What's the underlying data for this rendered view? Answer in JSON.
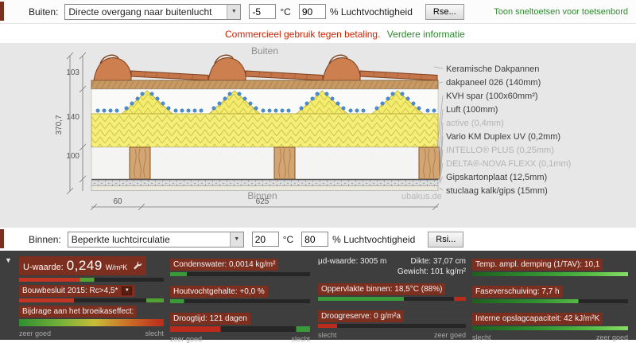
{
  "top_bar": {
    "label": "Buiten:",
    "select_value": "Directe overgang naar buitenlucht",
    "temp_value": "-5",
    "temp_unit": "°C",
    "humidity_value": "90",
    "humidity_unit": "% Luchtvochtigheid",
    "surface_button": "Rse...",
    "shortcuts_link": "Toon sneltoetsen voor toetsenbord"
  },
  "notice": {
    "commercial_text": "Commercieel gebruik tegen betaling.",
    "info_link": "Verdere informatie"
  },
  "drawing": {
    "outside_label": "Buiten",
    "inside_label": "Binnen",
    "watermark": "ubakus.de",
    "dims": {
      "total": "370,7",
      "top": "103",
      "middle": "140",
      "bottom": "100",
      "post_width": "60",
      "post_spacing": "625"
    },
    "layers": [
      {
        "label": "Keramische Dakpannen"
      },
      {
        "label": "dakpaneel 026 (140mm)"
      },
      {
        "label": "KVH spar (100x60mm²)"
      },
      {
        "label": "Luft (100mm)"
      },
      {
        "label": "active (0,4mm)"
      },
      {
        "label": "Vario KM Duplex UV (0,2mm)"
      },
      {
        "label": "INTELLO® PLUS (0,25mm)"
      },
      {
        "label": "DELTA®-NOVA FLEXX (0,1mm)"
      },
      {
        "label": "Gipskartonplaat (12,5mm)"
      },
      {
        "label": "stuclaag kalk/gips (15mm)"
      }
    ]
  },
  "bottom_bar": {
    "label": "Binnen:",
    "select_value": "Beperkte luchtcirculatie",
    "temp_value": "20",
    "temp_unit": "°C",
    "humidity_value": "80",
    "humidity_unit": "% Luchtvochtigheid",
    "surface_button": "Rsi..."
  },
  "results": {
    "u_label": "U-waarde:",
    "u_value": "0,249",
    "u_unit": "W/m²K",
    "bouwbesluit": "Bouwbesluit 2015: Rc>4,5*",
    "broeikas": "Bijdrage aan het broeikaseffect:",
    "condenswater": "Condenswater: 0,0014 kg/m²",
    "houtvocht": "Houtvochtgehalte: +0,0 %",
    "droogtijd": "Droogtijd: 121 dagen",
    "mu_d": "μd-waarde: 3005 m",
    "dikte": "Dikte: 37,07 cm",
    "gewicht": "Gewicht: 101 kg/m²",
    "oppervlakte": "Oppervlakte binnen: 18,5°C (88%)",
    "droogreserve": "Droogreserve: 0 g/m²a",
    "demping": "Temp. ampl. demping (1/TAV): 10,1",
    "fase": "Faseverschuiving: 7,7 h",
    "opslag": "Interne opslagcapaciteit: 42 kJ/m²K",
    "scale_good": "zeer goed",
    "scale_bad": "slecht"
  }
}
